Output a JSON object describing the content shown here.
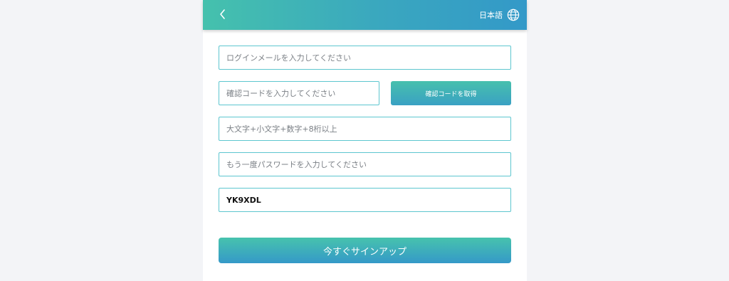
{
  "header": {
    "back_icon": "chevron-left-icon",
    "language_label": "日本語",
    "language_icon": "globe-icon"
  },
  "form": {
    "email_placeholder": "ログインメールを入力してください",
    "code_placeholder": "確認コードを入力してください",
    "get_code_label": "確認コードを取得",
    "password_placeholder": "大文字+小文字+数字+8桁以上",
    "confirm_password_placeholder": "もう一度パスワードを入力してください",
    "captcha_value": "YK9XDL",
    "signup_label": "今すぐサインアップ"
  },
  "colors": {
    "accent_start": "#45c1ad",
    "accent_end": "#3399c8",
    "field_border": "#5dc6cf",
    "background": "#f3f4f7"
  }
}
